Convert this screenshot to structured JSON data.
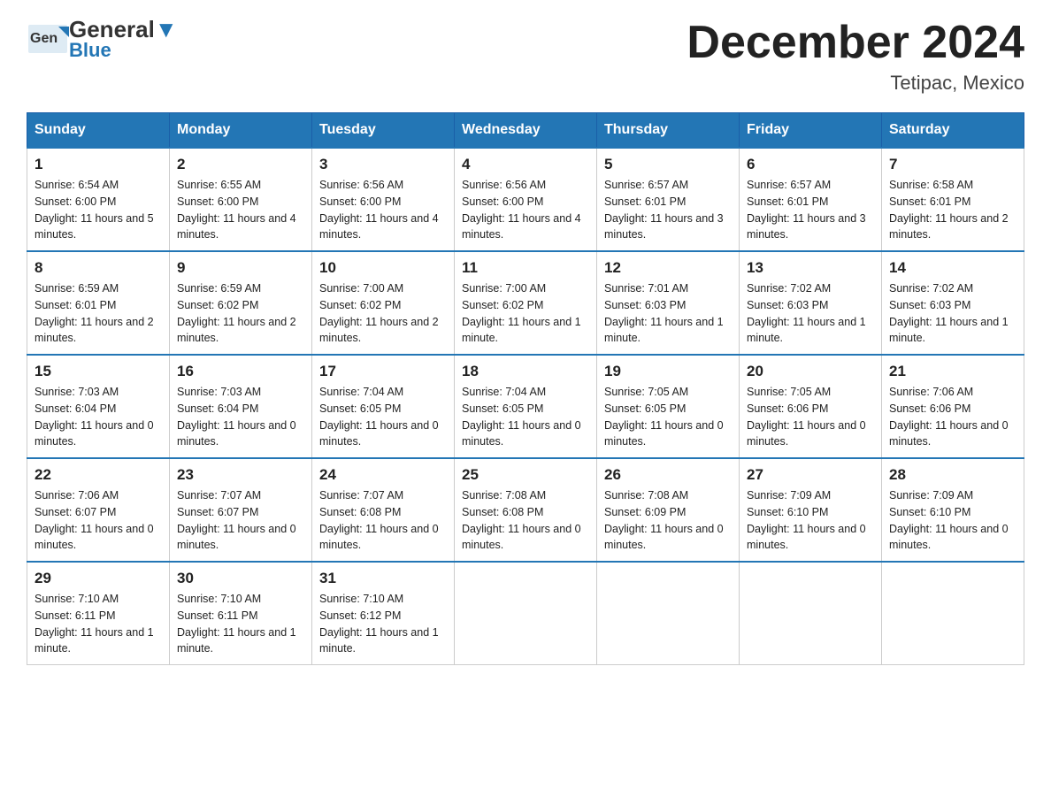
{
  "header": {
    "logo_general": "General",
    "logo_blue": "Blue",
    "month_title": "December 2024",
    "location": "Tetipac, Mexico"
  },
  "days_of_week": [
    "Sunday",
    "Monday",
    "Tuesday",
    "Wednesday",
    "Thursday",
    "Friday",
    "Saturday"
  ],
  "weeks": [
    [
      {
        "day": "1",
        "sunrise": "6:54 AM",
        "sunset": "6:00 PM",
        "daylight": "11 hours and 5 minutes."
      },
      {
        "day": "2",
        "sunrise": "6:55 AM",
        "sunset": "6:00 PM",
        "daylight": "11 hours and 4 minutes."
      },
      {
        "day": "3",
        "sunrise": "6:56 AM",
        "sunset": "6:00 PM",
        "daylight": "11 hours and 4 minutes."
      },
      {
        "day": "4",
        "sunrise": "6:56 AM",
        "sunset": "6:00 PM",
        "daylight": "11 hours and 4 minutes."
      },
      {
        "day": "5",
        "sunrise": "6:57 AM",
        "sunset": "6:01 PM",
        "daylight": "11 hours and 3 minutes."
      },
      {
        "day": "6",
        "sunrise": "6:57 AM",
        "sunset": "6:01 PM",
        "daylight": "11 hours and 3 minutes."
      },
      {
        "day": "7",
        "sunrise": "6:58 AM",
        "sunset": "6:01 PM",
        "daylight": "11 hours and 2 minutes."
      }
    ],
    [
      {
        "day": "8",
        "sunrise": "6:59 AM",
        "sunset": "6:01 PM",
        "daylight": "11 hours and 2 minutes."
      },
      {
        "day": "9",
        "sunrise": "6:59 AM",
        "sunset": "6:02 PM",
        "daylight": "11 hours and 2 minutes."
      },
      {
        "day": "10",
        "sunrise": "7:00 AM",
        "sunset": "6:02 PM",
        "daylight": "11 hours and 2 minutes."
      },
      {
        "day": "11",
        "sunrise": "7:00 AM",
        "sunset": "6:02 PM",
        "daylight": "11 hours and 1 minute."
      },
      {
        "day": "12",
        "sunrise": "7:01 AM",
        "sunset": "6:03 PM",
        "daylight": "11 hours and 1 minute."
      },
      {
        "day": "13",
        "sunrise": "7:02 AM",
        "sunset": "6:03 PM",
        "daylight": "11 hours and 1 minute."
      },
      {
        "day": "14",
        "sunrise": "7:02 AM",
        "sunset": "6:03 PM",
        "daylight": "11 hours and 1 minute."
      }
    ],
    [
      {
        "day": "15",
        "sunrise": "7:03 AM",
        "sunset": "6:04 PM",
        "daylight": "11 hours and 0 minutes."
      },
      {
        "day": "16",
        "sunrise": "7:03 AM",
        "sunset": "6:04 PM",
        "daylight": "11 hours and 0 minutes."
      },
      {
        "day": "17",
        "sunrise": "7:04 AM",
        "sunset": "6:05 PM",
        "daylight": "11 hours and 0 minutes."
      },
      {
        "day": "18",
        "sunrise": "7:04 AM",
        "sunset": "6:05 PM",
        "daylight": "11 hours and 0 minutes."
      },
      {
        "day": "19",
        "sunrise": "7:05 AM",
        "sunset": "6:05 PM",
        "daylight": "11 hours and 0 minutes."
      },
      {
        "day": "20",
        "sunrise": "7:05 AM",
        "sunset": "6:06 PM",
        "daylight": "11 hours and 0 minutes."
      },
      {
        "day": "21",
        "sunrise": "7:06 AM",
        "sunset": "6:06 PM",
        "daylight": "11 hours and 0 minutes."
      }
    ],
    [
      {
        "day": "22",
        "sunrise": "7:06 AM",
        "sunset": "6:07 PM",
        "daylight": "11 hours and 0 minutes."
      },
      {
        "day": "23",
        "sunrise": "7:07 AM",
        "sunset": "6:07 PM",
        "daylight": "11 hours and 0 minutes."
      },
      {
        "day": "24",
        "sunrise": "7:07 AM",
        "sunset": "6:08 PM",
        "daylight": "11 hours and 0 minutes."
      },
      {
        "day": "25",
        "sunrise": "7:08 AM",
        "sunset": "6:08 PM",
        "daylight": "11 hours and 0 minutes."
      },
      {
        "day": "26",
        "sunrise": "7:08 AM",
        "sunset": "6:09 PM",
        "daylight": "11 hours and 0 minutes."
      },
      {
        "day": "27",
        "sunrise": "7:09 AM",
        "sunset": "6:10 PM",
        "daylight": "11 hours and 0 minutes."
      },
      {
        "day": "28",
        "sunrise": "7:09 AM",
        "sunset": "6:10 PM",
        "daylight": "11 hours and 0 minutes."
      }
    ],
    [
      {
        "day": "29",
        "sunrise": "7:10 AM",
        "sunset": "6:11 PM",
        "daylight": "11 hours and 1 minute."
      },
      {
        "day": "30",
        "sunrise": "7:10 AM",
        "sunset": "6:11 PM",
        "daylight": "11 hours and 1 minute."
      },
      {
        "day": "31",
        "sunrise": "7:10 AM",
        "sunset": "6:12 PM",
        "daylight": "11 hours and 1 minute."
      },
      null,
      null,
      null,
      null
    ]
  ]
}
